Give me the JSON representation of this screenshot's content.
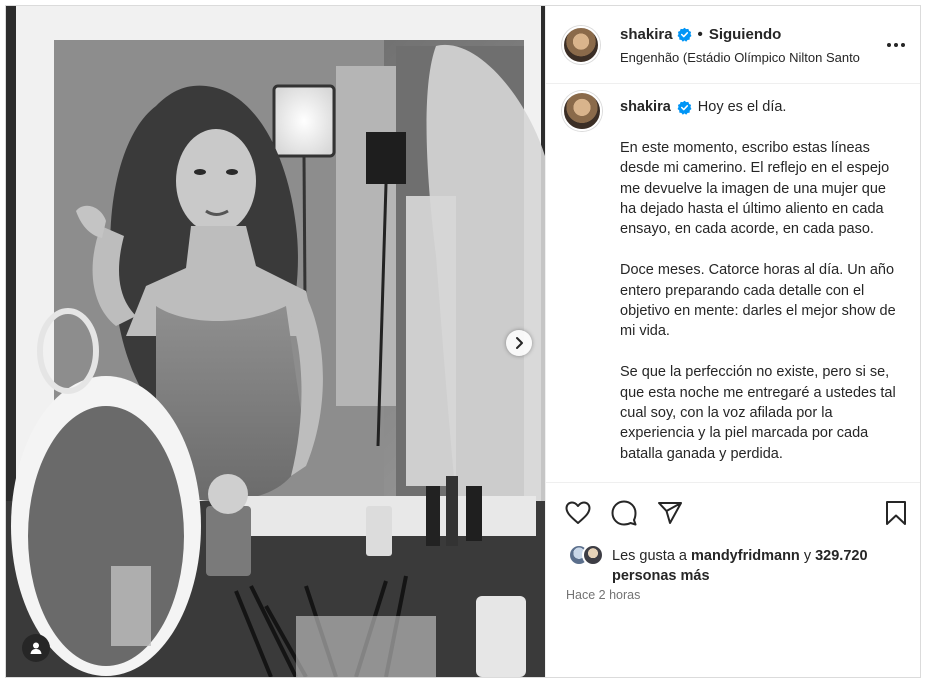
{
  "post": {
    "username": "shakira",
    "follow_status": "Siguiendo",
    "separator": "•",
    "location": "Engenhão (Estádio Olímpico Nilton Santo",
    "more_icon": "more-horizontal-icon",
    "verified_color": "#0095f6"
  },
  "caption": {
    "username": "shakira",
    "first_line": "Hoy es el día.",
    "paragraphs": [
      "En este momento, escribo estas líneas desde mi camerino. El reflejo en el espejo me devuelve la imagen de una mujer que ha dejado hasta el último aliento en cada ensayo, en cada acorde, en cada paso.",
      "Doce meses. Catorce horas al día. Un año entero preparando cada detalle con el objetivo en mente: darles el mejor show de mi vida.",
      "Se que la perfección no existe, pero si se, que esta noche me entregaré a ustedes tal cual soy, con la voz afilada por la experiencia y la piel marcada por cada batalla ganada y perdida."
    ]
  },
  "actions": {
    "like_icon": "heart-icon",
    "comment_icon": "comment-icon",
    "share_icon": "paper-plane-icon",
    "save_icon": "bookmark-icon"
  },
  "likes": {
    "prefix": "Les gusta a",
    "user": "mandyfridmann",
    "connector": "y",
    "count": "329.720",
    "suffix": "personas más"
  },
  "timestamp": "Hace 2 horas",
  "media": {
    "next_icon": "chevron-right-icon",
    "tag_icon": "user-tag-icon",
    "style": "black-and-white photo of a woman with long curly hair looking into a dressing room mirror"
  }
}
